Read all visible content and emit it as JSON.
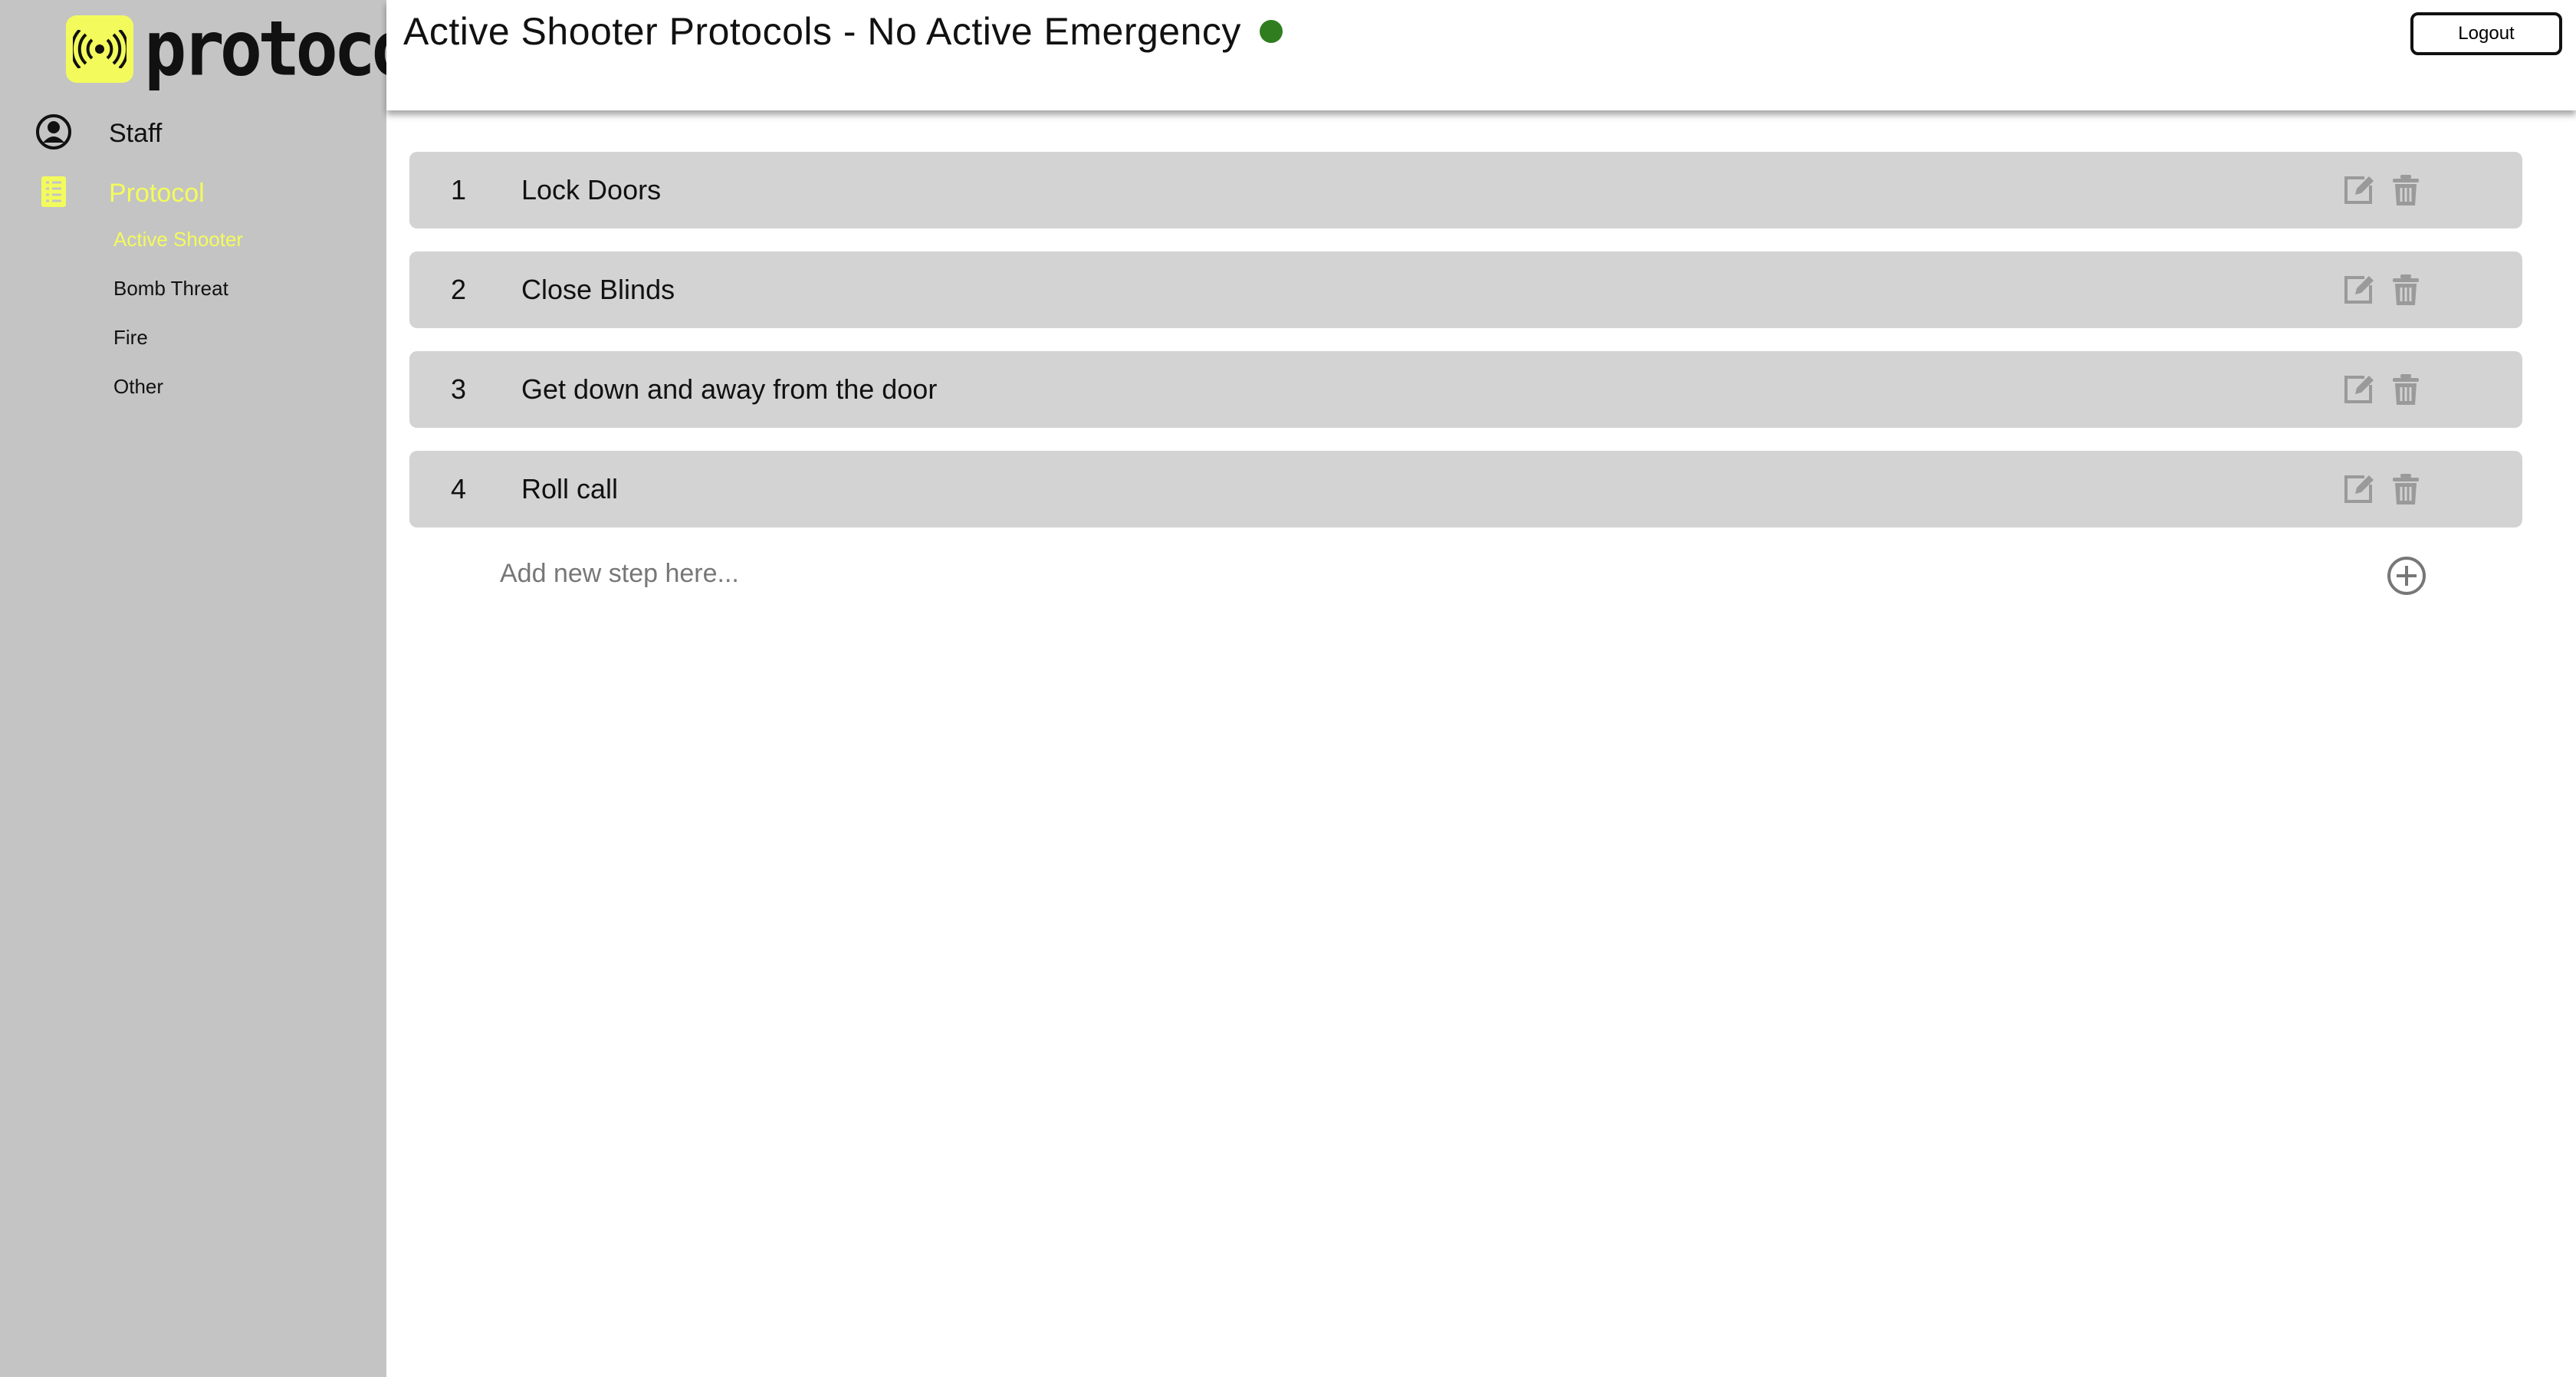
{
  "brand": {
    "name": "protocol",
    "accent_color": "#f3fb5c",
    "badge_icon": "broadcast-icon"
  },
  "sidebar": {
    "items": [
      {
        "label": "Staff",
        "icon": "user-circle-icon"
      },
      {
        "label": "Protocol",
        "icon": "checklist-icon"
      }
    ],
    "protocol_subitems": [
      {
        "label": "Active Shooter",
        "active": true
      },
      {
        "label": "Bomb Threat",
        "active": false
      },
      {
        "label": "Fire",
        "active": false
      },
      {
        "label": "Other",
        "active": false
      }
    ]
  },
  "header": {
    "title": "Active Shooter Protocols - No Active Emergency",
    "status_color": "#2f7d1f",
    "logout_label": "Logout"
  },
  "steps": [
    {
      "number": "1",
      "text": "Lock Doors"
    },
    {
      "number": "2",
      "text": "Close Blinds"
    },
    {
      "number": "3",
      "text": "Get down and away from the door"
    },
    {
      "number": "4",
      "text": "Roll call"
    }
  ],
  "add_step": {
    "placeholder": "Add new step here..."
  }
}
